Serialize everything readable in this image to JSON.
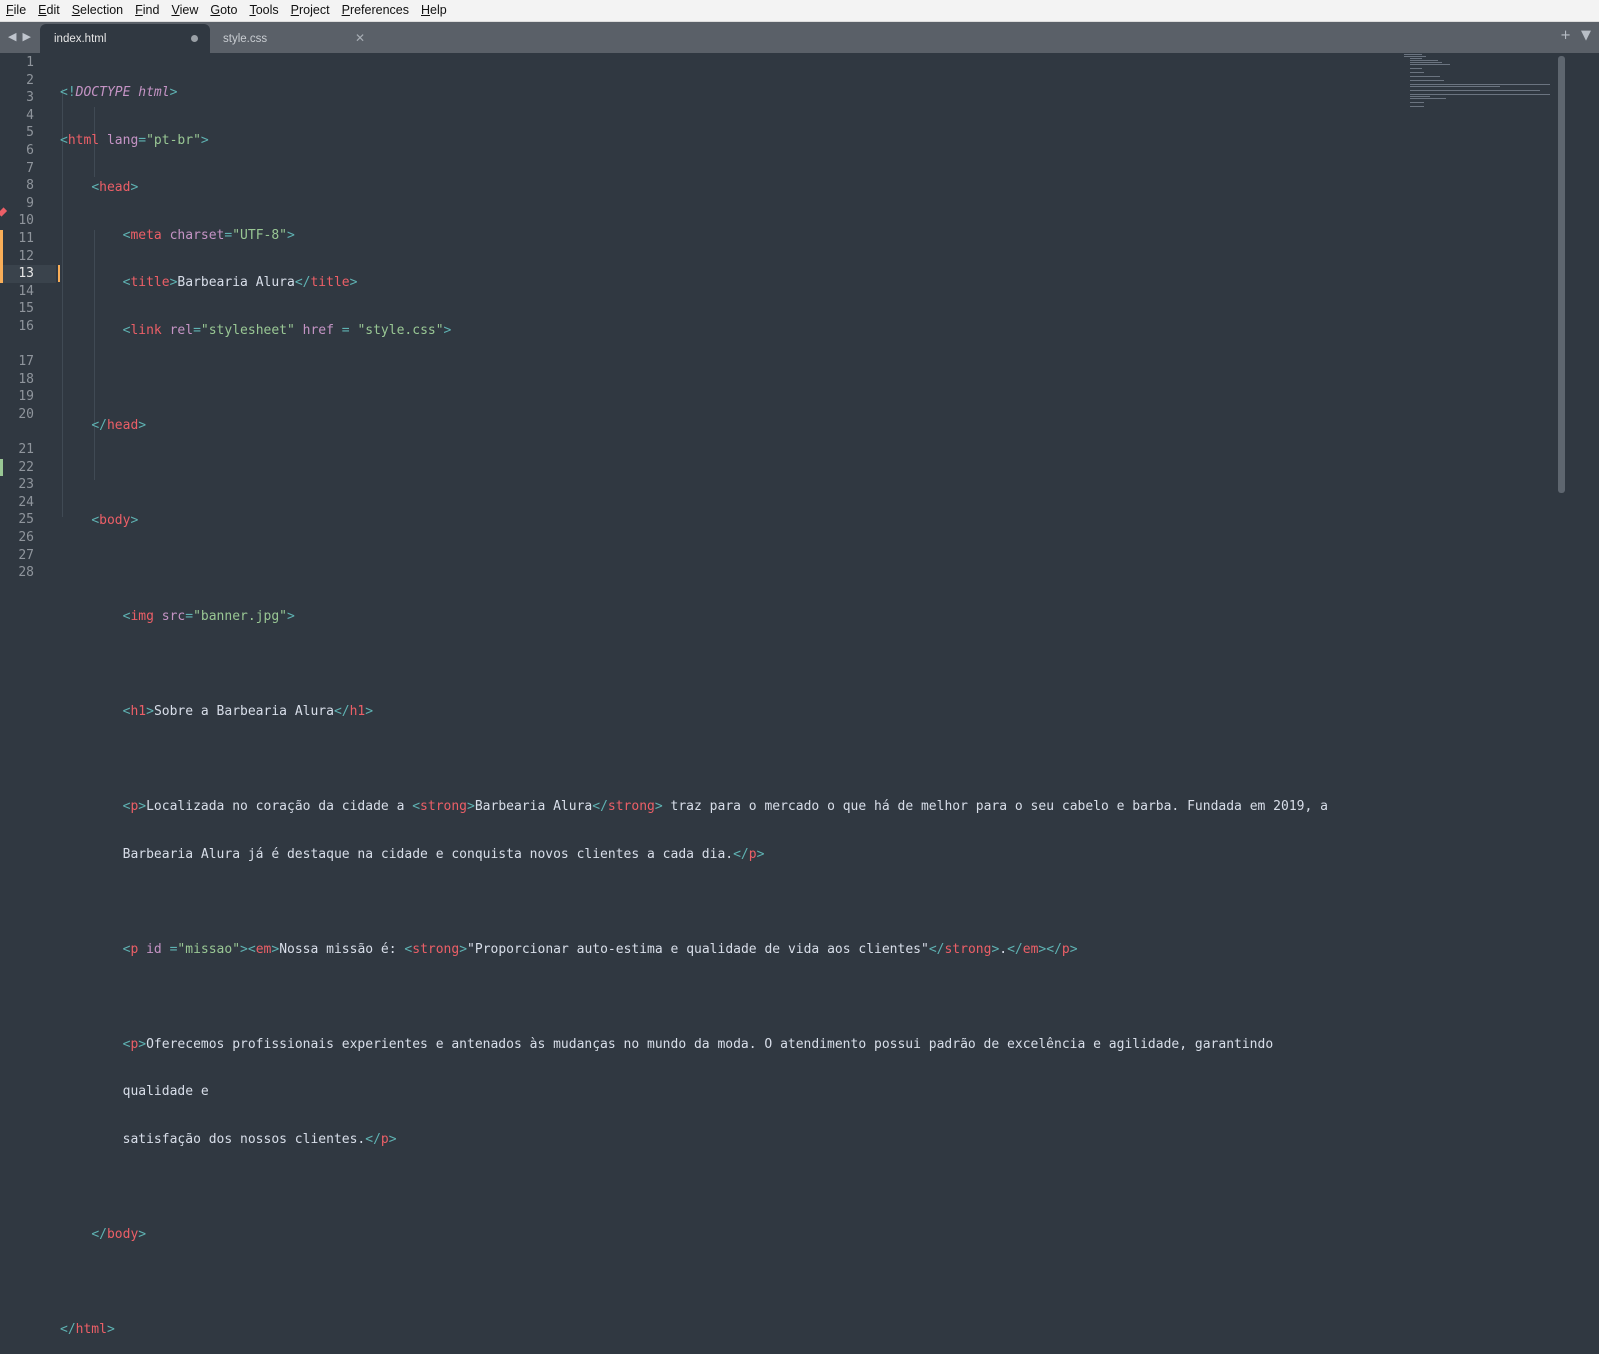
{
  "menu": [
    "File",
    "Edit",
    "Selection",
    "Find",
    "View",
    "Goto",
    "Tools",
    "Project",
    "Preferences",
    "Help"
  ],
  "tabs": [
    {
      "label": "index.html",
      "active": true,
      "modified": true
    },
    {
      "label": "style.css",
      "active": false
    }
  ],
  "icons": {
    "nav_left": "triangle-left",
    "nav_right": "triangle-right",
    "new_tab": "plus",
    "tab_menu": "triangle-down"
  },
  "colors": {
    "background": "#303841",
    "tag": "#ec5f67",
    "punct": "#5fb3b3",
    "attr": "#c594c5",
    "string": "#99c794",
    "text": "#d8dee9",
    "modified_marker": "#f9ae58",
    "added_marker": "#99c794"
  },
  "editor": {
    "current_line": 13,
    "line_numbers": [
      "1",
      "2",
      "3",
      "4",
      "5",
      "6",
      "7",
      "8",
      "9",
      "10",
      "11",
      "12",
      "13",
      "14",
      "15",
      "16",
      "",
      "17",
      "18",
      "19",
      "20",
      "",
      "21",
      "22",
      "23",
      "24",
      "25",
      "26",
      "27",
      "28"
    ]
  }
}
